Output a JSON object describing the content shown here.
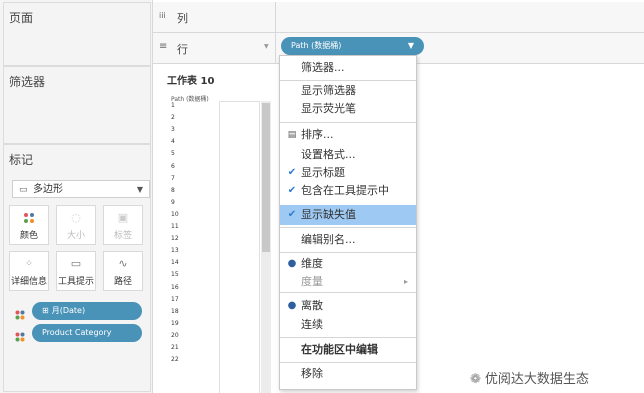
{
  "left": {
    "pages_title": "页面",
    "filters_title": "筛选器",
    "marks_title": "标记",
    "mark_type": "多边形",
    "mark_buttons": [
      "颜色",
      "大小",
      "标签",
      "详细信息",
      "工具提示",
      "路径"
    ],
    "mark_pills": [
      "月(Date)",
      "Product Category"
    ]
  },
  "shelves": {
    "columns_label": "列",
    "rows_label": "行",
    "rows_pill": "Path (数据桶)"
  },
  "sheet": {
    "title": "工作表 10",
    "header": "Path (数据桶)",
    "rows": [
      "1",
      "2",
      "3",
      "4",
      "5",
      "6",
      "7",
      "8",
      "9",
      "10",
      "11",
      "12",
      "13",
      "14",
      "15",
      "16",
      "17",
      "18",
      "19",
      "20",
      "21",
      "22"
    ]
  },
  "menu": {
    "items": [
      {
        "label": "筛选器..."
      },
      {
        "label": "显示筛选器"
      },
      {
        "label": "显示荧光笔"
      },
      {
        "label": "排序..."
      },
      {
        "label": "设置格式..."
      },
      {
        "label": "显示标题"
      },
      {
        "label": "包含在工具提示中"
      },
      {
        "label": "显示缺失值"
      },
      {
        "label": "编辑别名..."
      },
      {
        "label": "维度"
      },
      {
        "label": "度量"
      },
      {
        "label": "离散"
      },
      {
        "label": "连续"
      },
      {
        "label": "在功能区中编辑"
      },
      {
        "label": "移除"
      }
    ]
  },
  "watermark": "优阅达大数据生态",
  "colors": {
    "pill": "#4a93b8",
    "highlight": "#9ec9f3",
    "check": "#2f7bd0"
  }
}
